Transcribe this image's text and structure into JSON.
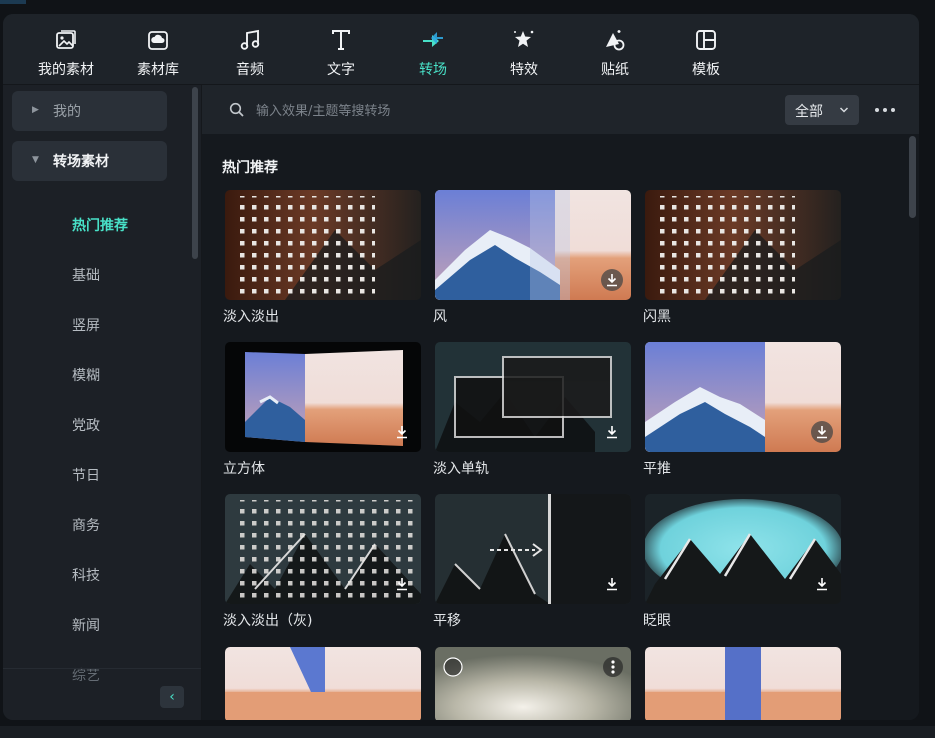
{
  "toolbar": {
    "tabs": [
      {
        "label": "我的素材",
        "icon": "my-media-icon"
      },
      {
        "label": "素材库",
        "icon": "cloud-library-icon"
      },
      {
        "label": "音频",
        "icon": "music-note-icon"
      },
      {
        "label": "文字",
        "icon": "text-icon"
      },
      {
        "label": "转场",
        "icon": "transition-icon",
        "active": true
      },
      {
        "label": "特效",
        "icon": "effects-icon"
      },
      {
        "label": "贴纸",
        "icon": "sticker-icon"
      },
      {
        "label": "模板",
        "icon": "template-icon"
      }
    ]
  },
  "sidebar": {
    "groups": [
      {
        "label": "我的",
        "expanded": false
      },
      {
        "label": "转场素材",
        "expanded": true
      }
    ],
    "items": [
      "热门推荐",
      "基础",
      "竖屏",
      "模糊",
      "党政",
      "节日",
      "商务",
      "科技",
      "新闻",
      "综艺"
    ],
    "selected": "热门推荐"
  },
  "search": {
    "placeholder": "输入效果/主题等搜转场",
    "filter_value": "全部"
  },
  "main": {
    "section_title": "热门推荐",
    "cards": [
      {
        "name": "淡入淡出"
      },
      {
        "name": "风"
      },
      {
        "name": "闪黑"
      },
      {
        "name": "立方体"
      },
      {
        "name": "淡入单轨"
      },
      {
        "name": "平推"
      },
      {
        "name": "淡入淡出（灰)"
      },
      {
        "name": "平移"
      },
      {
        "name": "眨眼"
      }
    ]
  },
  "colors": {
    "accent": "#48e0c7",
    "panel": "#1c2026",
    "content_bg": "#15191e"
  }
}
